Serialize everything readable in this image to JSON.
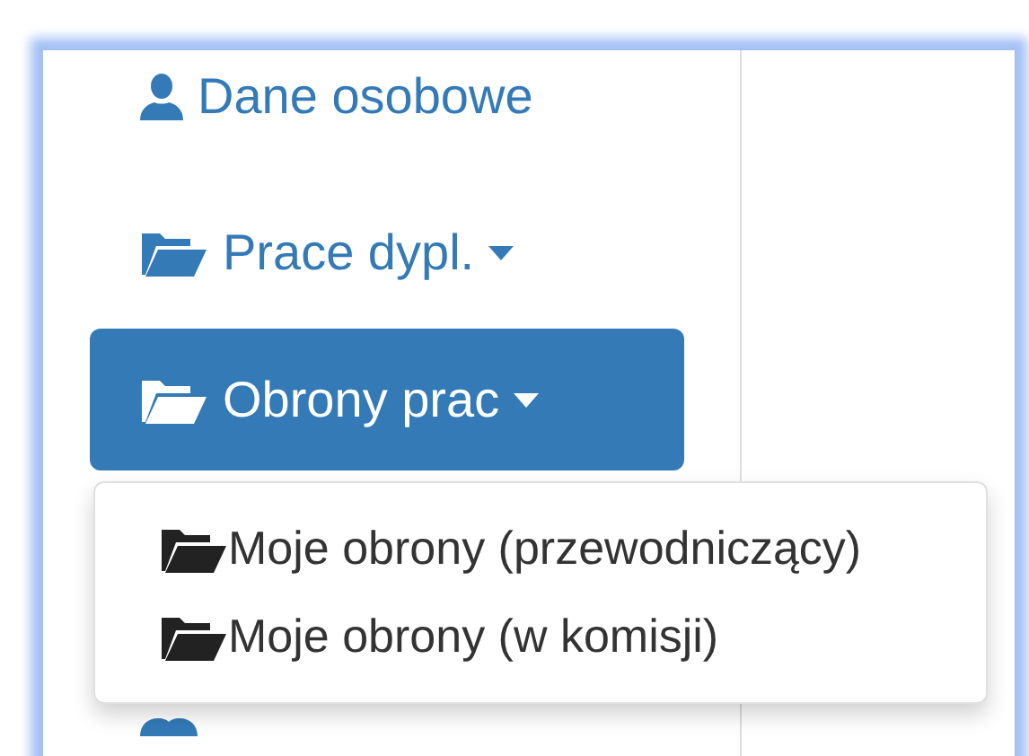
{
  "nav": [
    {
      "label": "Dane osobowe",
      "kind": "user",
      "dropdown": false,
      "selected": false
    },
    {
      "label": "Prace dypl.",
      "kind": "folder",
      "dropdown": true,
      "selected": false
    },
    {
      "label": "Obrony prac",
      "kind": "folder",
      "dropdown": true,
      "selected": true
    },
    {
      "kind": "people",
      "dropdown": false,
      "selected": false
    }
  ],
  "dropdown_menu": [
    {
      "label": "Moje obrony (przewodniczący)"
    },
    {
      "label": "Moje obrony (w komisji)"
    }
  ]
}
